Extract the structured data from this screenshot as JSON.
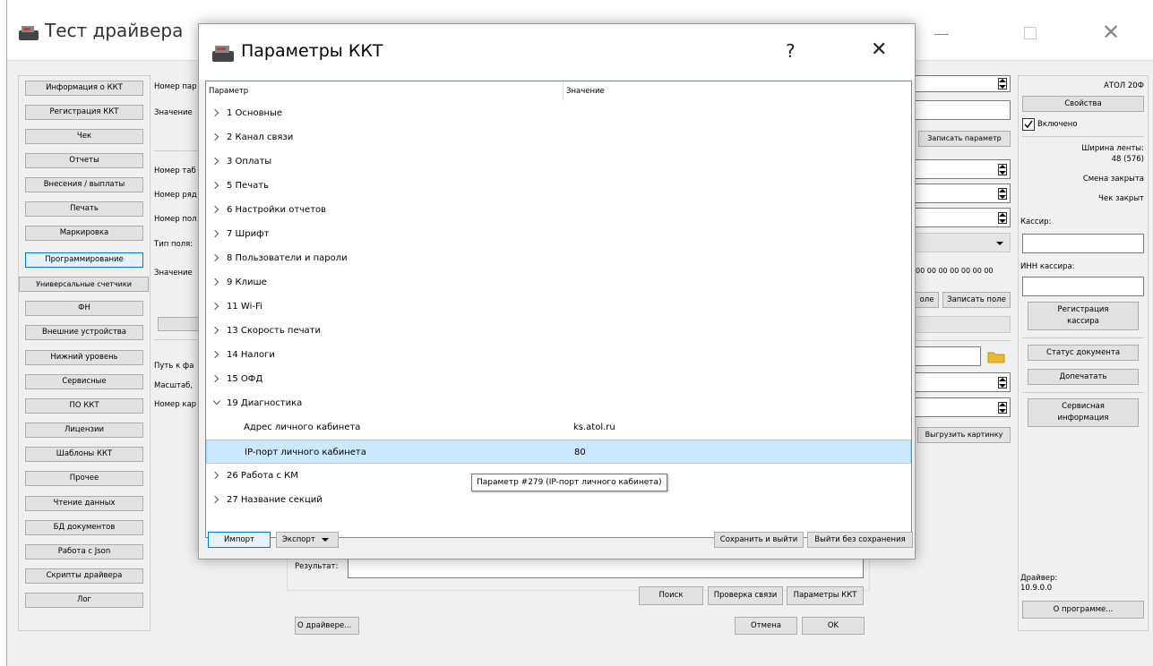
{
  "main_window": {
    "title": "Тест драйвера"
  },
  "left_nav": {
    "items": [
      {
        "label": "Информация о ККТ"
      },
      {
        "label": "Регистрация ККТ"
      },
      {
        "label": "Чек"
      },
      {
        "label": "Отчеты"
      },
      {
        "label": "Внесения / выплаты"
      },
      {
        "label": "Печать"
      },
      {
        "label": "Маркировка"
      },
      {
        "label": "Программирование"
      },
      {
        "label": "Универсальные счетчики"
      },
      {
        "label": "ФН"
      },
      {
        "label": "Внешние устройства"
      },
      {
        "label": "Нижний уровень"
      },
      {
        "label": "Сервисные"
      },
      {
        "label": "ПО ККТ"
      },
      {
        "label": "Лицензии"
      },
      {
        "label": "Шаблоны ККТ"
      },
      {
        "label": "Прочее"
      },
      {
        "label": "Чтение данных"
      },
      {
        "label": "БД документов"
      },
      {
        "label": "Работа с Json"
      },
      {
        "label": "Скрипты драйвера"
      },
      {
        "label": "Лог"
      }
    ]
  },
  "middle": {
    "labels": [
      "Номер пар",
      "Значение",
      "Номер таб",
      "Номер ряд",
      "Номер пол",
      "Тип поля:",
      "Значение",
      "Путь к фа",
      "Масштаб,",
      "Номер кар"
    ],
    "write_param_button": "Записать параметр",
    "hex_value": "00 00 00 00 00 00 00",
    "read_field_button": "оле",
    "write_field_button": "Записать поле",
    "upload_picture_button": "Выгрузить картинку"
  },
  "bottom": {
    "result_label": "Результат:",
    "result_value": "",
    "search_button": "Поиск",
    "check_link_button": "Проверка связи",
    "params_button": "Параметры ККТ",
    "about_driver_button": "О драйвере...",
    "cancel_button": "Отмена",
    "ok_button": "OK"
  },
  "right_panel": {
    "device_name": "АТОЛ 20Ф",
    "properties_button": "Свойства",
    "enabled_label": "Включено",
    "enabled_checked": true,
    "tape_width_label": "Ширина ленты:",
    "tape_width_value": "48 (576)",
    "shift_status": "Смена закрыта",
    "receipt_status": "Чек закрыт",
    "cashier_label": "Кассир:",
    "cashier_value": "",
    "cashier_inn_label": "ИНН кассира:",
    "cashier_inn_value": "",
    "register_cashier_button": "Регистрация кассира",
    "doc_status_button": "Статус документа",
    "reprint_button": "Допечатать",
    "service_info_button": "Сервисная информация",
    "driver_label": "Драйвер:",
    "driver_version": "10.9.0.0",
    "about_button": "О программе..."
  },
  "dialog": {
    "title": "Параметры ККТ",
    "help_glyph": "?",
    "close_glyph": "✕",
    "columns": {
      "param": "Параметр",
      "value": "Значение"
    },
    "rows": [
      {
        "name": "1 Основные",
        "value": "",
        "level": 0,
        "expanded": false
      },
      {
        "name": "2 Канал связи",
        "value": "",
        "level": 0,
        "expanded": false
      },
      {
        "name": "3 Оплаты",
        "value": "",
        "level": 0,
        "expanded": false
      },
      {
        "name": "5 Печать",
        "value": "",
        "level": 0,
        "expanded": false
      },
      {
        "name": "6 Настройки отчетов",
        "value": "",
        "level": 0,
        "expanded": false
      },
      {
        "name": "7 Шрифт",
        "value": "",
        "level": 0,
        "expanded": false
      },
      {
        "name": "8 Пользователи и пароли",
        "value": "",
        "level": 0,
        "expanded": false
      },
      {
        "name": "9 Клише",
        "value": "",
        "level": 0,
        "expanded": false
      },
      {
        "name": "11 Wi-Fi",
        "value": "",
        "level": 0,
        "expanded": false
      },
      {
        "name": "13 Скорость печати",
        "value": "",
        "level": 0,
        "expanded": false
      },
      {
        "name": "14 Налоги",
        "value": "",
        "level": 0,
        "expanded": false
      },
      {
        "name": "15 ОФД",
        "value": "",
        "level": 0,
        "expanded": false
      },
      {
        "name": "19 Диагностика",
        "value": "",
        "level": 0,
        "expanded": true
      },
      {
        "name": "Адрес личного кабинета",
        "value": "ks.atol.ru",
        "level": 1
      },
      {
        "name": "IP-порт личного кабинета",
        "value": "80",
        "level": 1,
        "selected": true
      },
      {
        "name": "26 Работа с КМ",
        "value": "",
        "level": 0,
        "expanded": false
      },
      {
        "name": "27 Название секций",
        "value": "",
        "level": 0,
        "expanded": false
      }
    ],
    "tooltip": "Параметр #279 (IP-порт личного кабинета)",
    "import_button": "Импорт",
    "export_button": "Экспорт",
    "save_exit_button": "Сохранить и выйти",
    "exit_nosave_button": "Выйти без сохранения"
  },
  "colors": {
    "selection": "#cce8ff",
    "accent": "#0078d7"
  }
}
